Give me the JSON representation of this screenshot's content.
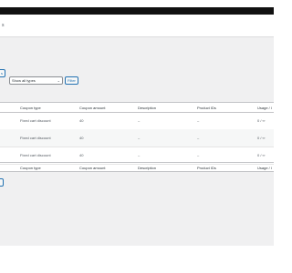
{
  "topbar": {
    "title": "s"
  },
  "toolbar": {
    "bulk_apply_label": "s",
    "type_filter": {
      "selected": "Show all types"
    },
    "filter_label": "Filter",
    "bottom_apply_label": ""
  },
  "table": {
    "columns": {
      "coupon_type": "Coupon type",
      "coupon_amount": "Coupon amount",
      "description": "Description",
      "product_ids": "Product IDs",
      "usage": "Usage / l"
    },
    "rows": [
      {
        "coupon_type": "Fixed cart discount",
        "coupon_amount": "40",
        "description": "–",
        "product_ids": "–",
        "usage": "0 / ∞"
      },
      {
        "coupon_type": "Fixed cart discount",
        "coupon_amount": "40",
        "description": "–",
        "product_ids": "–",
        "usage": "0 / ∞"
      },
      {
        "coupon_type": "Fixed cart discount",
        "coupon_amount": "40",
        "description": "–",
        "product_ids": "–",
        "usage": "0 / ∞"
      }
    ]
  }
}
